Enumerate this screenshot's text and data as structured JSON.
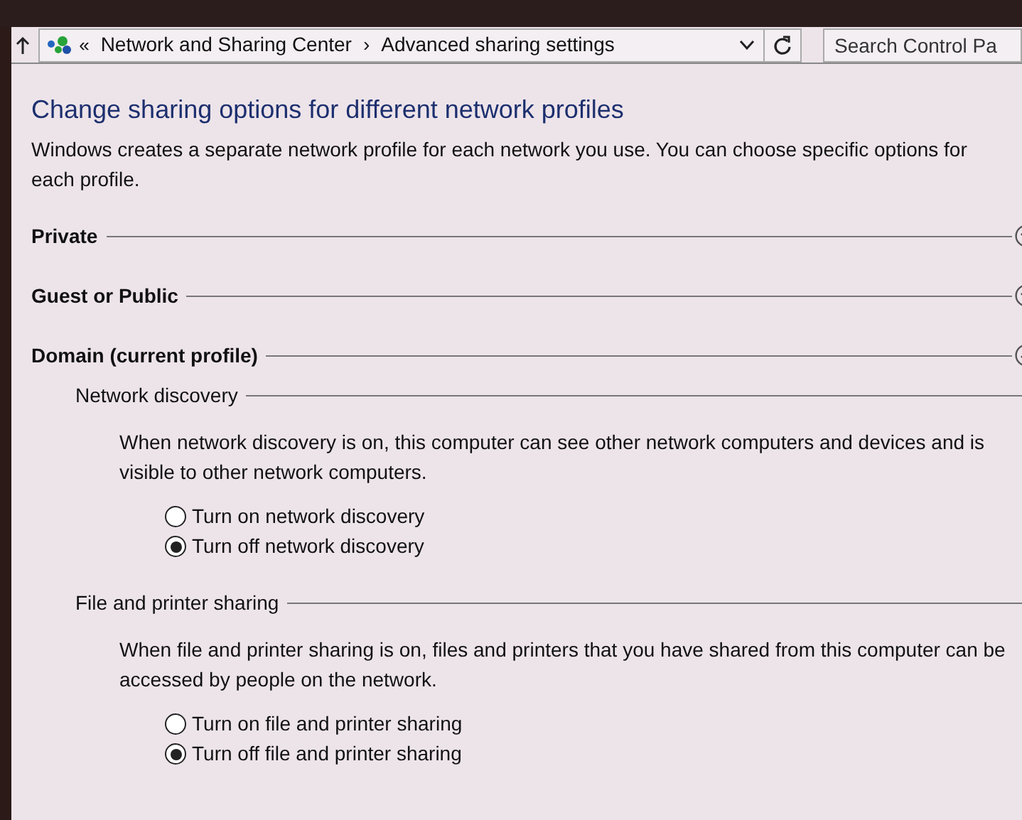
{
  "address_bar": {
    "overflow": "«",
    "breadcrumbs": [
      {
        "label": "Network and Sharing Center"
      },
      {
        "label": "Advanced sharing settings"
      }
    ],
    "separator": "›"
  },
  "search": {
    "placeholder": "Search Control Pa"
  },
  "heading": "Change sharing options for different network profiles",
  "description": "Windows creates a separate network profile for each network you use. You can choose specific options for each profile.",
  "profiles": [
    {
      "name": "Private",
      "expanded": false
    },
    {
      "name": "Guest or Public",
      "expanded": false
    },
    {
      "name": "Domain (current profile)",
      "expanded": true,
      "sections": [
        {
          "title": "Network discovery",
          "description": "When network discovery is on, this computer can see other network computers and devices and is visible to other network computers.",
          "options": [
            {
              "label": "Turn on network discovery",
              "selected": false
            },
            {
              "label": "Turn off network discovery",
              "selected": true
            }
          ]
        },
        {
          "title": "File and printer sharing",
          "description": "When file and printer sharing is on, files and printers that you have shared from this computer can be accessed by people on the network.",
          "options": [
            {
              "label": "Turn on file and printer sharing",
              "selected": false
            },
            {
              "label": "Turn off file and printer sharing",
              "selected": true
            }
          ]
        }
      ]
    }
  ]
}
